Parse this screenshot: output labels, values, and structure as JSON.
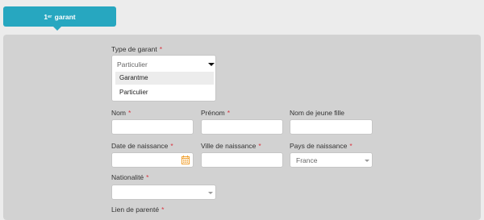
{
  "tab": {
    "label": "garant",
    "ordinal_num": "1",
    "ordinal_sup": "er"
  },
  "form": {
    "type_garant": {
      "label": "Type de garant",
      "required_mark": "*",
      "selected": "Particulier",
      "options": [
        "Garantme",
        "Particulier"
      ]
    },
    "nom": {
      "label": "Nom",
      "required_mark": "*",
      "value": ""
    },
    "prenom": {
      "label": "Prénom",
      "required_mark": "*",
      "value": ""
    },
    "nom_jeune_fille": {
      "label": "Nom de jeune fille",
      "value": ""
    },
    "date_naissance": {
      "label": "Date de naissance",
      "required_mark": "*",
      "value": "",
      "icon": "calendar-icon"
    },
    "ville_naissance": {
      "label": "Ville de naissance",
      "required_mark": "*",
      "value": ""
    },
    "pays_naissance": {
      "label": "Pays de naissance",
      "required_mark": "*",
      "selected": "France"
    },
    "nationalite": {
      "label": "Nationalité",
      "required_mark": "*",
      "selected": ""
    },
    "lien_parente": {
      "label": "Lien de parenté",
      "required_mark": "*"
    }
  },
  "colors": {
    "accent": "#27a7c0",
    "required": "#d9333f",
    "panel": "#d2d2d2",
    "calendar_icon": "#f0a030"
  }
}
